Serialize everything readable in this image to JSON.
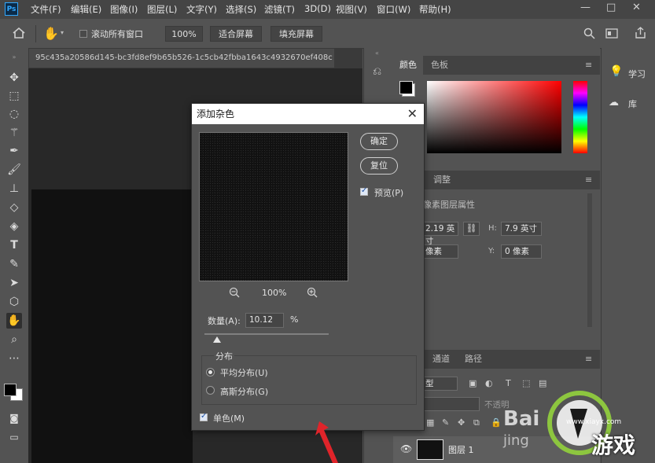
{
  "app": {
    "logo": "Ps"
  },
  "menu": [
    "文件(F)",
    "编辑(E)",
    "图像(I)",
    "图层(L)",
    "文字(Y)",
    "选择(S)",
    "滤镜(T)",
    "3D(D)",
    "视图(V)",
    "窗口(W)",
    "帮助(H)"
  ],
  "window_controls": {
    "minimize": "—",
    "restore": "□",
    "close": "✕"
  },
  "options": {
    "scroll_all_label": "滚动所有窗口",
    "zoom_value": "100%",
    "fit_screen": "适合屏幕",
    "fill_screen": "填充屏幕"
  },
  "document": {
    "tab_title": "95c435a20586d145-bc3fd8ef9b65b526-1c5cb42fbba1643c4932670ef408c"
  },
  "panels": {
    "color_tab": "颜色",
    "swatches_tab": "色板",
    "adjust_tab": "调整",
    "properties_title": "像素图层属性",
    "w_value": "2.19 英寸",
    "h_label": "H:",
    "h_value": "7.9 英寸",
    "x_value": "像素",
    "y_label": "Y:",
    "y_value": "0 像素",
    "channels_tab": "通道",
    "paths_tab": "路径",
    "filter_kind": "型",
    "opacity_label": "不透明",
    "layer_name": "图层 1"
  },
  "far_right": {
    "learn": "学习",
    "libraries": "库"
  },
  "dialog": {
    "title": "添加杂色",
    "close": "✕",
    "ok": "确定",
    "reset": "复位",
    "preview_label": "预览(P)",
    "zoom": "100%",
    "amount_label": "数量(A):",
    "amount_value": "10.12",
    "amount_unit": "%",
    "amount_fraction": 0.1012,
    "distribution_label": "分布",
    "uniform": "平均分布(U)",
    "gaussian": "高斯分布(G)",
    "monochrome": "单色(M)",
    "preview_checked": true,
    "monochrome_checked": true,
    "uniform_selected": true
  },
  "watermark": {
    "brand": "Bai",
    "site": "jing",
    "text_big": "游戏",
    "domain": "www.xiayx.com",
    "colors": {
      "ring": "#8dc63f",
      "dark": "#1a1a1a"
    }
  },
  "colors": {
    "accent": "#31a8ff",
    "arrow": "#e0242a"
  }
}
